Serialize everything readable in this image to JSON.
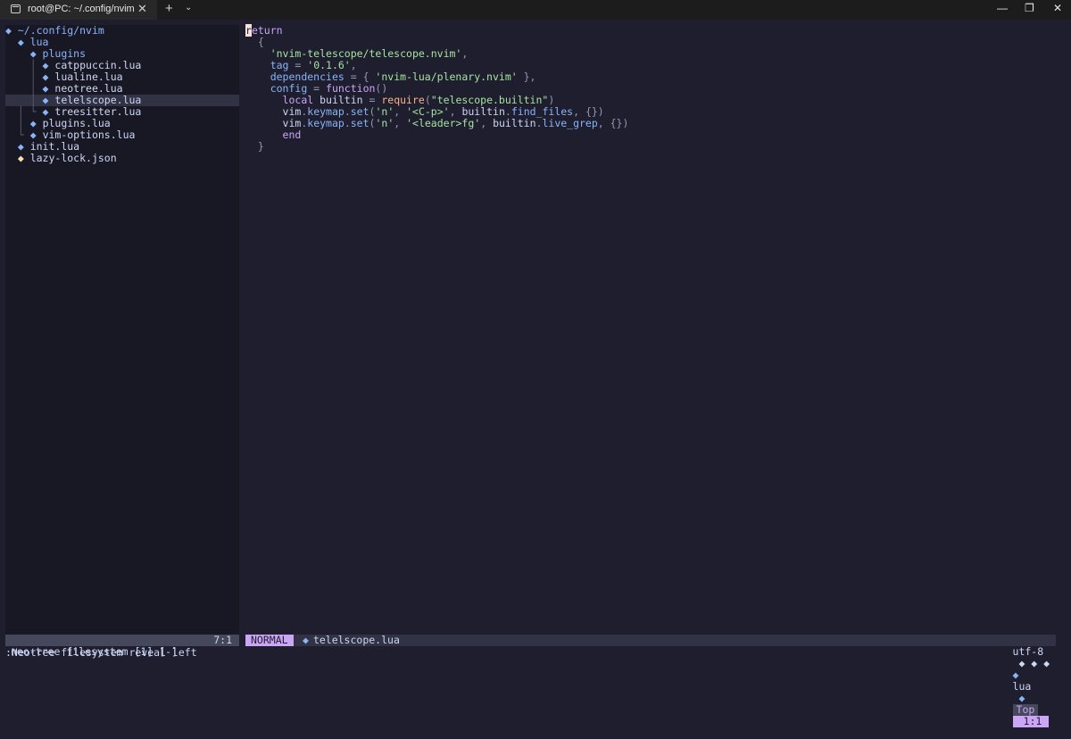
{
  "window": {
    "tab_title": "root@PC: ~/.config/nvim",
    "tab_close": "✕",
    "new_tab": "+",
    "dropdown": "⌄",
    "minimize": "—",
    "maximize": "❐",
    "close": "✕"
  },
  "tree": {
    "root": "~/.config/nvim",
    "items": [
      {
        "label": "lua",
        "type": "dir"
      },
      {
        "label": "plugins",
        "type": "dir"
      },
      {
        "label": "catppuccin.lua",
        "type": "file"
      },
      {
        "label": "lualine.lua",
        "type": "file"
      },
      {
        "label": "neotree.lua",
        "type": "file"
      },
      {
        "label": "telelscope.lua",
        "type": "file",
        "selected": true
      },
      {
        "label": "treesitter.lua",
        "type": "file"
      },
      {
        "label": "plugins.lua",
        "type": "file"
      },
      {
        "label": "vim-options.lua",
        "type": "file"
      },
      {
        "label": "init.lua",
        "type": "file"
      },
      {
        "label": "lazy-lock.json",
        "type": "json"
      }
    ]
  },
  "editor": {
    "code": {
      "l1": "return",
      "l2_open": "{",
      "l3_str": "'nvim-telescope/telescope.nvim'",
      "l4_key": "tag",
      "l4_val": "'0.1.6'",
      "l5_key": "dependencies",
      "l5_val": "'nvim-lua/plenary.nvim'",
      "l6_key": "config",
      "l6_fn": "function",
      "l7_local": "local",
      "l7_var": "builtin",
      "l7_req": "require",
      "l7_str": "\"telescope.builtin\"",
      "l8_obj": "vim",
      "l8_method": "keymap",
      "l8_set": "set",
      "l8_mode": "'n'",
      "l8_key": "'<C-p>'",
      "l8_builtin": "builtin",
      "l8_fn": "find_files",
      "l9_key": "'<leader>fg'",
      "l9_fn": "live_grep",
      "l10": "end",
      "l11": "}"
    }
  },
  "status": {
    "tree_left": "neo-tree filesystem [1] [-]",
    "tree_pos": "7:1",
    "mode": "NORMAL",
    "filename": "telelscope.lua",
    "encoding": "utf-8",
    "filetype": "lua",
    "scroll": "Top",
    "cursor": "1:1"
  },
  "cmdline": ":Neotree filesystem reveal left"
}
